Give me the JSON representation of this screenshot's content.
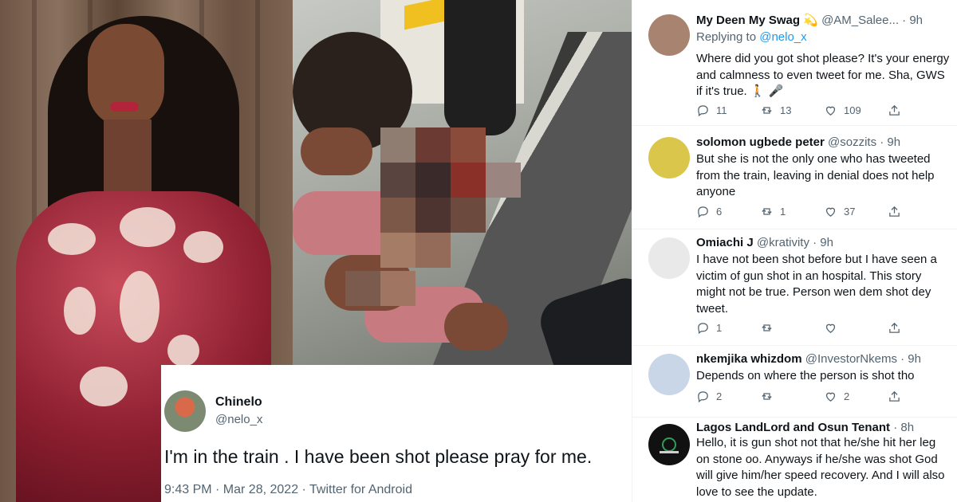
{
  "tweet": {
    "name": "Chinelo",
    "handle": "@nelo_x",
    "text": "I'm in the train .  I have been shot please pray for me.",
    "meta": "9:43 PM · Mar 28, 2022 · Twitter for Android"
  },
  "replies": [
    {
      "name": "My Deen My Swag 💫",
      "handle": "@AM_Salee... · 9h",
      "replying_prefix": "Replying to ",
      "replying_to": "@nelo_x",
      "text": "Where did you got shot please? It's your energy and calmness to even tweet for me. Sha, GWS if it's true. 🚶 🎤",
      "replies": "11",
      "retweets": "13",
      "likes": "109",
      "avatar_color": "#a88370"
    },
    {
      "name": "solomon ugbede peter",
      "handle": "@sozzits · 9h",
      "text": "But she is not the only one who has tweeted from the train, leaving in denial does not help anyone",
      "replies": "6",
      "retweets": "1",
      "likes": "37",
      "avatar_color": "#d9c64a"
    },
    {
      "name": "Omiachi J",
      "handle": "@krativity · 9h",
      "text": "I have not been shot before but I have seen a victim of gun shot in an hospital. This story might not be true. Person wen dem shot dey tweet.",
      "replies": "1",
      "retweets": "",
      "likes": "",
      "avatar_color": "#e9e9e9"
    },
    {
      "name": "nkemjika whizdom",
      "handle": "@InvestorNkems · 9h",
      "text": "Depends on where the person is shot tho",
      "replies": "2",
      "retweets": "",
      "likes": "2",
      "avatar_color": "#c9d6e8"
    },
    {
      "name": "Lagos LandLord and Osun Tenant",
      "handle": "· 8h",
      "text": "Hello, it is gun shot not that he/she hit her leg on stone oo. Anyways if he/she was shot God will give him/her speed recovery. And I will also love to see the update.",
      "replies": "",
      "retweets": "",
      "likes": "",
      "avatar_color": "#111111"
    }
  ],
  "icons": [
    "reply-icon",
    "retweet-icon",
    "like-icon",
    "share-icon"
  ]
}
